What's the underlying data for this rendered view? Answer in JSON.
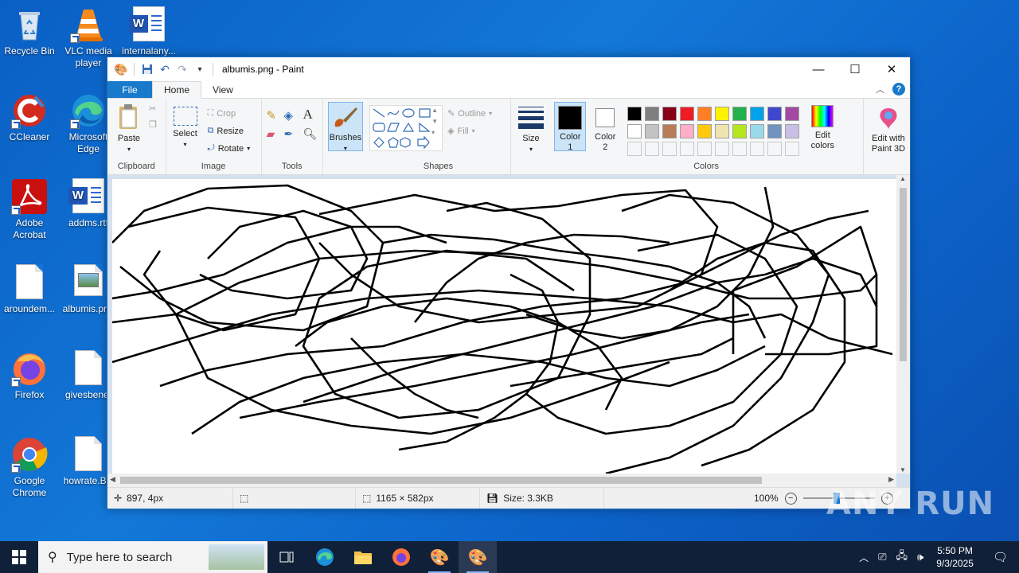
{
  "desktop": {
    "icons": [
      {
        "label": "Recycle Bin",
        "icon": "recycle-bin-icon"
      },
      {
        "label": "VLC media player",
        "icon": "vlc-icon"
      },
      {
        "label": "internalany...",
        "icon": "word-document-icon"
      },
      {
        "label": "CCleaner",
        "icon": "ccleaner-icon"
      },
      {
        "label": "Microsoft Edge",
        "icon": "edge-icon"
      },
      {
        "label": "Adobe Acrobat",
        "icon": "acrobat-icon"
      },
      {
        "label": "addms.rtf",
        "icon": "word-document-icon"
      },
      {
        "label": "aroundem...",
        "icon": "blank-file-icon"
      },
      {
        "label": "albumis.png",
        "icon": "image-file-icon"
      },
      {
        "label": "Firefox",
        "icon": "firefox-icon"
      },
      {
        "label": "givesbenef",
        "icon": "blank-file-icon"
      },
      {
        "label": "Google Chrome",
        "icon": "chrome-icon"
      },
      {
        "label": "howrate.BC",
        "icon": "blank-file-icon"
      }
    ]
  },
  "window": {
    "title": "albumis.png - Paint",
    "controls": {
      "minimize": "—",
      "maximize": "☐",
      "close": "✕"
    }
  },
  "ribbon": {
    "tabs": {
      "file": "File",
      "home": "Home",
      "view": "View"
    },
    "clipboard": {
      "paste": "Paste",
      "label": "Clipboard"
    },
    "image": {
      "select": "Select",
      "crop": "Crop",
      "resize": "Resize",
      "rotate": "Rotate",
      "label": "Image"
    },
    "tools": {
      "label": "Tools"
    },
    "brushes": {
      "label": "Brushes"
    },
    "shapes": {
      "outline": "Outline",
      "fill": "Fill",
      "label": "Shapes"
    },
    "size": {
      "label": "Size"
    },
    "colors": {
      "color1": "Color",
      "color1_num": "1",
      "color2": "Color",
      "color2_num": "2",
      "edit_colors_1": "Edit",
      "edit_colors_2": "colors",
      "label": "Colors",
      "palette_row1": [
        "#000000",
        "#7f7f7f",
        "#880015",
        "#ed1c24",
        "#ff7f27",
        "#fff200",
        "#22b14c",
        "#00a2e8",
        "#3f48cc",
        "#a349a4"
      ],
      "palette_row2": [
        "#ffffff",
        "#c3c3c3",
        "#b97a57",
        "#ffaec9",
        "#ffc90e",
        "#efe4b0",
        "#b5e61d",
        "#99d9ea",
        "#7092be",
        "#c8bfe7"
      ],
      "color1_value": "#000000",
      "color2_value": "#ffffff"
    },
    "paint3d": {
      "line1": "Edit with",
      "line2": "Paint 3D"
    }
  },
  "status": {
    "cursor": "897, 4px",
    "dimensions": "1165 × 582px",
    "size": "Size: 3.3KB",
    "zoom": "100%"
  },
  "taskbar": {
    "search_placeholder": "Type here to search",
    "time": "5:50 PM",
    "date": "9/3/2025"
  },
  "watermark": "ANY RUN"
}
